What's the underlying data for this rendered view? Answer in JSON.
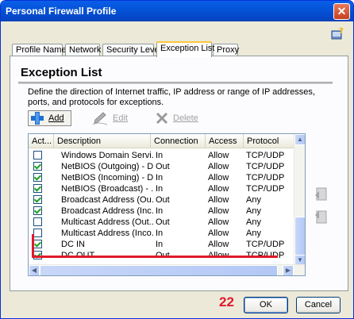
{
  "window": {
    "title": "Personal Firewall Profile"
  },
  "title_buttons": {
    "close": "✕"
  },
  "tabs": [
    {
      "label": "Profile Name",
      "active": false
    },
    {
      "label": "Network",
      "active": false
    },
    {
      "label": "Security Level",
      "active": false
    },
    {
      "label": "Exception List",
      "active": true
    },
    {
      "label": "Proxy",
      "active": false
    }
  ],
  "panel": {
    "heading": "Exception List",
    "description": "Define the direction of Internet traffic, IP address or range of IP addresses, ports, and protocols for exceptions."
  },
  "toolbar": {
    "add_label": "Add",
    "edit_label": "Edit",
    "delete_label": "Delete"
  },
  "table": {
    "columns": [
      "Act...",
      "Description",
      "Connection",
      "Access",
      "Protocol"
    ],
    "rows": [
      {
        "active": false,
        "description": "Windows Domain Servi...",
        "connection": "In",
        "access": "Allow",
        "protocol": "TCP/UDP"
      },
      {
        "active": true,
        "description": "NetBIOS (Outgoing) - D...",
        "connection": "Out",
        "access": "Allow",
        "protocol": "TCP/UDP"
      },
      {
        "active": true,
        "description": "NetBIOS (Incoming) - D...",
        "connection": "In",
        "access": "Allow",
        "protocol": "TCP/UDP"
      },
      {
        "active": true,
        "description": "NetBIOS (Broadcast) - ...",
        "connection": "In",
        "access": "Allow",
        "protocol": "TCP/UDP"
      },
      {
        "active": true,
        "description": "Broadcast Address (Ou...",
        "connection": "Out",
        "access": "Allow",
        "protocol": "Any"
      },
      {
        "active": true,
        "description": "Broadcast Address (Inc...",
        "connection": "In",
        "access": "Allow",
        "protocol": "Any"
      },
      {
        "active": false,
        "description": "Multicast Address (Out...",
        "connection": "Out",
        "access": "Allow",
        "protocol": "Any"
      },
      {
        "active": false,
        "description": "Multicast Address (Inco...",
        "connection": "In",
        "access": "Allow",
        "protocol": "Any"
      },
      {
        "active": true,
        "description": "DC IN",
        "connection": "In",
        "access": "Allow",
        "protocol": "TCP/UDP"
      },
      {
        "active": true,
        "description": "DC OUT",
        "connection": "Out",
        "access": "Allow",
        "protocol": "TCP/UDP"
      }
    ]
  },
  "annotation": {
    "number": "22",
    "color": "#e0192b"
  },
  "buttons": {
    "ok": "OK",
    "cancel": "Cancel"
  },
  "colors": {
    "title_bar": "#0454d8",
    "active_tab_accent": "#ffc83c",
    "checkbox_check": "#21a121"
  },
  "icons": {
    "help": "help-question-icon",
    "add": "plus-icon",
    "edit": "pencil-icon",
    "delete": "x-delete-icon",
    "move_up": "move-up-icon",
    "move_down": "move-down-icon"
  }
}
